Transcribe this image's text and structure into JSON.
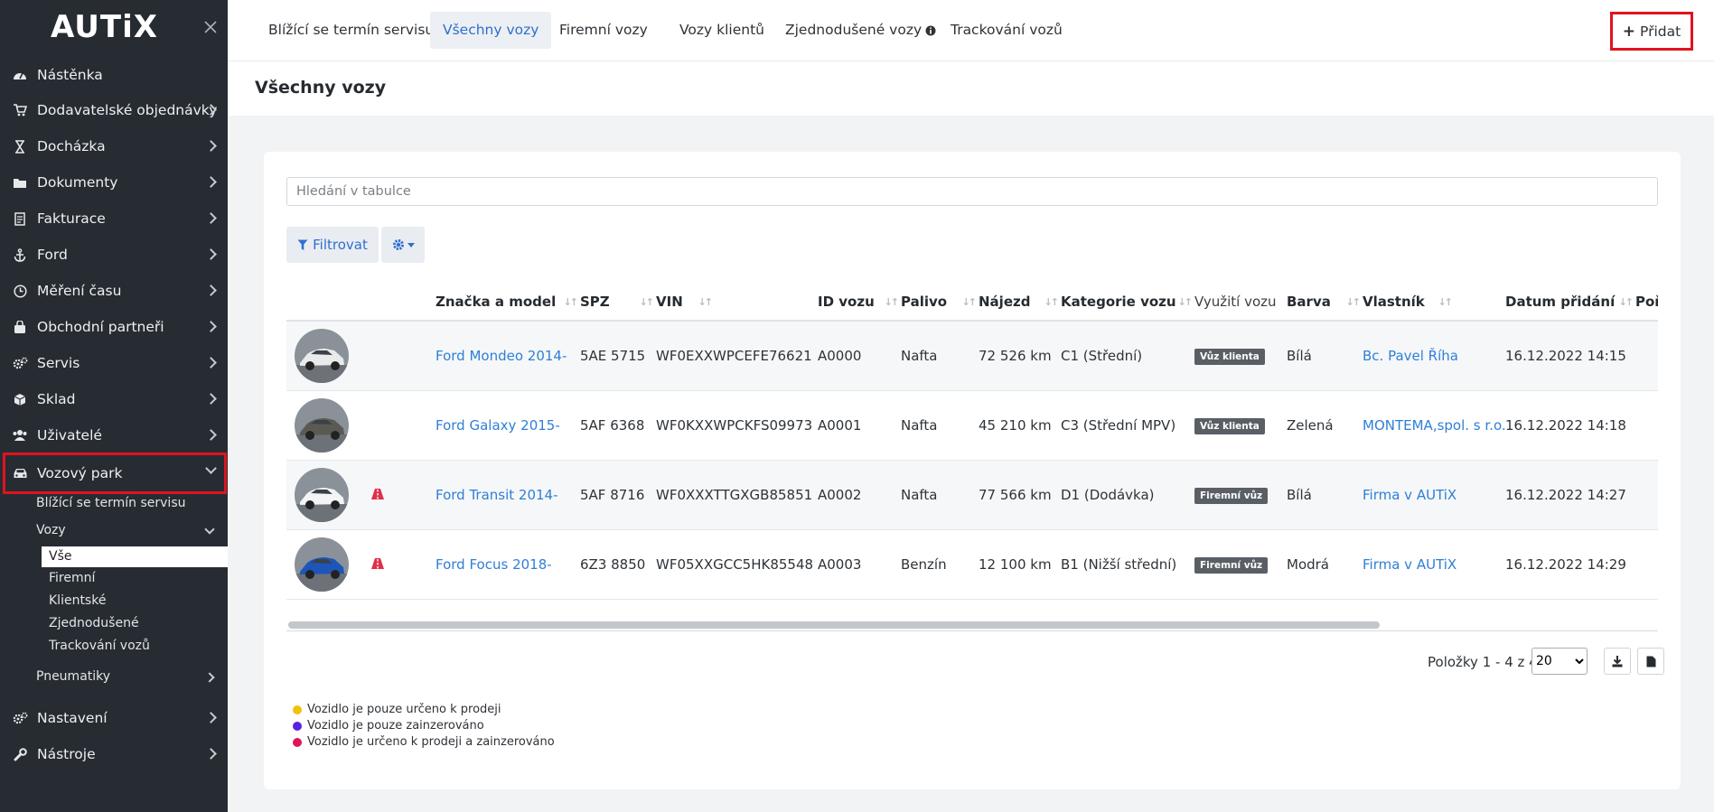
{
  "app": {
    "logo": "AUTiX"
  },
  "sidebar": {
    "items": [
      {
        "label": "Nástěnka",
        "icon": "dashboard-icon"
      },
      {
        "label": "Dodavatelské objednávky",
        "icon": "cart-icon"
      },
      {
        "label": "Docházka",
        "icon": "hourglass-icon"
      },
      {
        "label": "Dokumenty",
        "icon": "folder-icon"
      },
      {
        "label": "Fakturace",
        "icon": "invoice-icon"
      },
      {
        "label": "Ford",
        "icon": "anchor-icon"
      },
      {
        "label": "Měření času",
        "icon": "clock-icon"
      },
      {
        "label": "Obchodní partneři",
        "icon": "partners-icon"
      },
      {
        "label": "Servis",
        "icon": "cogs-icon"
      },
      {
        "label": "Sklad",
        "icon": "cubes-icon"
      },
      {
        "label": "Uživatelé",
        "icon": "users-icon"
      },
      {
        "label": "Vozový park",
        "icon": "car-icon"
      },
      {
        "label": "Nastavení",
        "icon": "cogs-icon"
      },
      {
        "label": "Nástroje",
        "icon": "wrench-icon"
      }
    ],
    "sub": {
      "upcoming": "Blížící se termín servisu",
      "cars": "Vozy",
      "all": "Vše",
      "company": "Firemní",
      "client": "Klientské",
      "simplified": "Zjednodušené",
      "tracking": "Trackování vozů",
      "tires": "Pneumatiky"
    }
  },
  "tabs": [
    "Blížící se termín servisu",
    "Všechny vozy",
    "Firemní vozy",
    "Vozy klientů",
    "Zjednodušené vozy",
    "Trackování vozů"
  ],
  "add_button": "Přidat",
  "page_title": "Všechny vozy",
  "search_placeholder": "Hledání v tabulce",
  "filter_label": "Filtrovat",
  "table": {
    "headers": [
      "Značka a model",
      "SPZ",
      "VIN",
      "ID vozu",
      "Palivo",
      "Nájezd",
      "Kategorie vozu",
      "Využití vozu",
      "Barva",
      "Vlastník",
      "Datum přidání",
      "Poř"
    ],
    "rows": [
      {
        "model": "Ford Mondeo 2014-",
        "spz": "5AE 5715",
        "vin": "WF0EXXWPCEFE76621",
        "id": "A0000",
        "fuel": "Nafta",
        "mileage": "72 526 km",
        "category": "C1 (Střední)",
        "usage": "Vůz klienta",
        "color": "Bílá",
        "owner": "Bc. Pavel Říha",
        "date": "16.12.2022 14:15",
        "car_color": "#e9eaec"
      },
      {
        "model": "Ford Galaxy 2015-",
        "spz": "5AF 6368",
        "vin": "WF0KXXWPCKFS09973",
        "id": "A0001",
        "fuel": "Nafta",
        "mileage": "45 210 km",
        "category": "C3 (Střední MPV)",
        "usage": "Vůz klienta",
        "color": "Zelená",
        "owner": "MONTEMA,spol. s r.o.",
        "date": "16.12.2022 14:18",
        "car_color": "#5b5a52"
      },
      {
        "model": "Ford Transit 2014-",
        "spz": "5AF 8716",
        "vin": "WF0XXXTTGXGB85851",
        "id": "A0002",
        "fuel": "Nafta",
        "mileage": "77 566 km",
        "category": "D1 (Dodávka)",
        "usage": "Firemní vůz",
        "color": "Bílá",
        "owner": "Firma v AUTiX",
        "date": "16.12.2022 14:27",
        "car_color": "#f2f4f6"
      },
      {
        "model": "Ford Focus 2018-",
        "spz": "6Z3 8850",
        "vin": "WF05XXGCC5HK85548",
        "id": "A0003",
        "fuel": "Benzín",
        "mileage": "12 100 km",
        "category": "B1 (Nižší střední)",
        "usage": "Firemní vůz",
        "color": "Modrá",
        "owner": "Firma v AUTiX",
        "date": "16.12.2022 14:29",
        "car_color": "#1d56b8"
      }
    ]
  },
  "pager": {
    "text": "Položky 1 - 4 z 4",
    "page_size": "20"
  },
  "legend": [
    {
      "text": "Vozidlo je pouze určeno k prodeji",
      "color": "#f2c10a"
    },
    {
      "text": "Vozidlo je pouze zainzerováno",
      "color": "#5a21e0"
    },
    {
      "text": "Vozidlo je určeno k prodeji a zainzerováno",
      "color": "#e01555"
    }
  ]
}
